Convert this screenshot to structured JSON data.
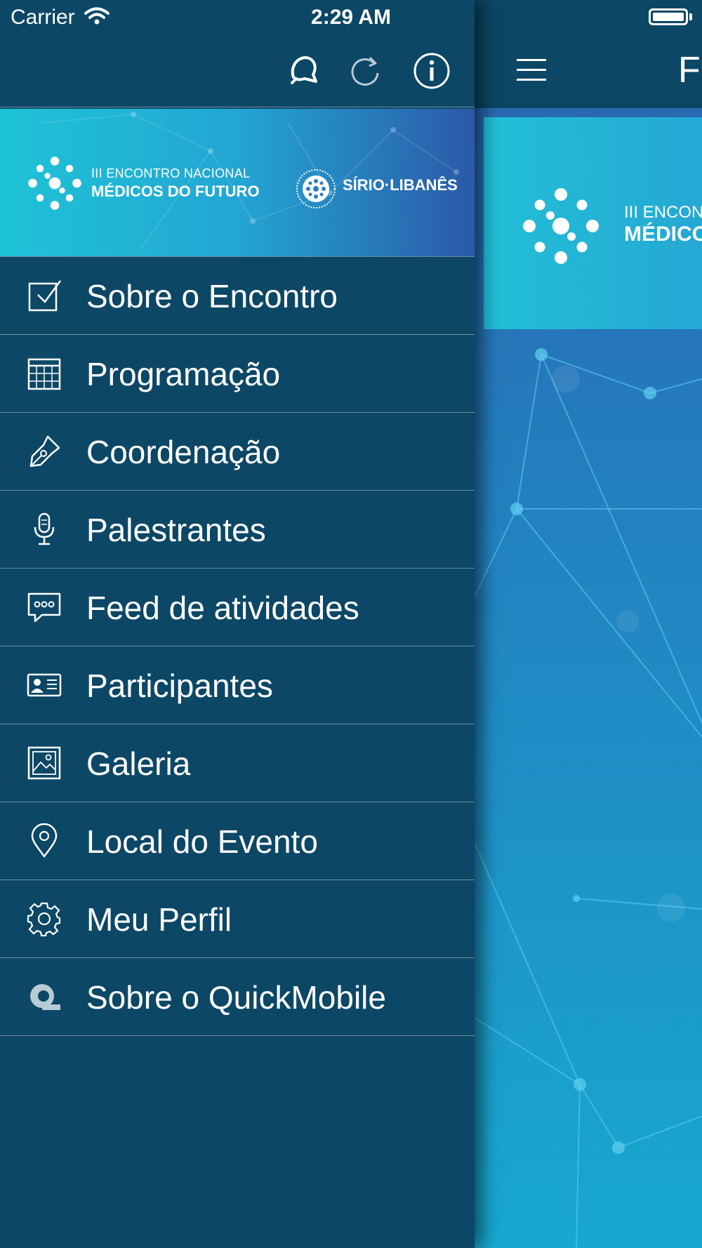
{
  "status_bar": {
    "carrier": "Carrier",
    "time": "2:29 AM"
  },
  "toolbar": {
    "icons": [
      "notification-bell-icon",
      "refresh-icon",
      "info-icon"
    ]
  },
  "drawer_banner": {
    "line1": "III ENCONTRO NACIONAL",
    "line2": "MÉDICOS DO FUTURO",
    "sponsor": "SÍRIO·LIBANÊS"
  },
  "menu": {
    "items": [
      {
        "label": "Sobre o Encontro",
        "icon": "checkbox-icon"
      },
      {
        "label": "Programação",
        "icon": "calendar-icon"
      },
      {
        "label": "Coordenação",
        "icon": "pen-nib-icon"
      },
      {
        "label": "Palestrantes",
        "icon": "microphone-icon"
      },
      {
        "label": "Feed de atividades",
        "icon": "chat-bubble-icon"
      },
      {
        "label": "Participantes",
        "icon": "id-card-icon"
      },
      {
        "label": "Galeria",
        "icon": "image-icon"
      },
      {
        "label": "Local do Evento",
        "icon": "map-pin-icon"
      },
      {
        "label": "Meu Perfil",
        "icon": "gear-icon"
      },
      {
        "label": "Sobre o QuickMobile",
        "icon": "quickmobile-icon"
      }
    ]
  },
  "main_screen": {
    "nav_title": "Fe",
    "banner_line1": "III ENCONTR",
    "banner_line2": "MÉDICOS"
  },
  "colors": {
    "navy": "#0c4766",
    "divider": "#6f8fa3",
    "banner_cyan": "#1ec3d6",
    "banner_blue": "#2b59a8"
  }
}
